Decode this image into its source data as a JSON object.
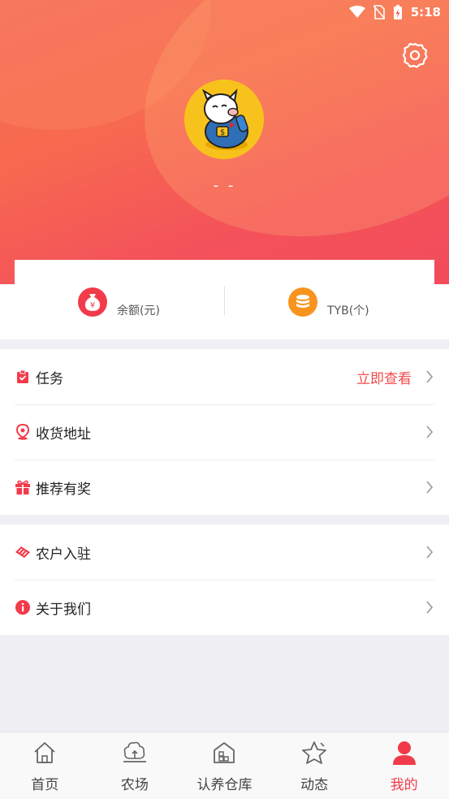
{
  "status_bar": {
    "time": "5:18",
    "icons": [
      "wifi-icon",
      "no-sim-icon",
      "battery-charging-icon"
    ]
  },
  "header": {
    "settings_icon": "gear-icon",
    "nickname": "- -"
  },
  "wallet": {
    "balance_label": "余额(元)",
    "coin_label": "TYB(个)",
    "balance_icon_glyph": "¥"
  },
  "menu_group_1": [
    {
      "label": "任务",
      "extra": "立即查看",
      "icon": "task-clipboard-icon"
    },
    {
      "label": "收货地址",
      "extra": "",
      "icon": "location-pin-icon"
    },
    {
      "label": "推荐有奖",
      "extra": "",
      "icon": "gift-icon"
    }
  ],
  "menu_group_2": [
    {
      "label": "农户入驻",
      "extra": "",
      "icon": "handshake-icon"
    },
    {
      "label": "关于我们",
      "extra": "",
      "icon": "info-icon"
    }
  ],
  "tabbar": [
    {
      "label": "首页",
      "icon": "home-icon",
      "active": false
    },
    {
      "label": "农场",
      "icon": "farm-tree-icon",
      "active": false
    },
    {
      "label": "认养仓库",
      "icon": "warehouse-icon",
      "active": false
    },
    {
      "label": "动态",
      "icon": "star-icon",
      "active": false
    },
    {
      "label": "我的",
      "icon": "user-icon",
      "active": true
    }
  ],
  "colors": {
    "accent": "#f23b4a",
    "hero": "#f4525a",
    "coin_orange": "#f7941e"
  }
}
